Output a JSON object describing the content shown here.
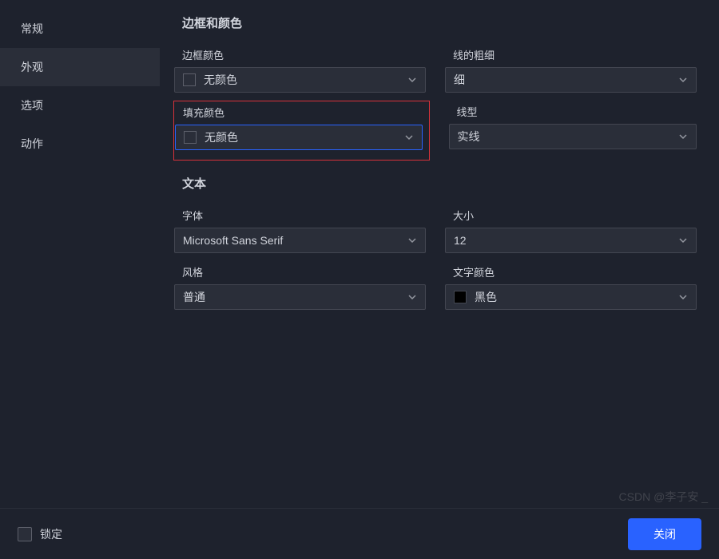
{
  "sidebar": {
    "items": [
      {
        "label": "常规"
      },
      {
        "label": "外观"
      },
      {
        "label": "选项"
      },
      {
        "label": "动作"
      }
    ],
    "activeIndex": 1
  },
  "sections": {
    "border": {
      "title": "边框和颜色",
      "borderColor": {
        "label": "边框颜色",
        "value": "无颜色"
      },
      "lineWeight": {
        "label": "线的粗细",
        "value": "细"
      },
      "fillColor": {
        "label": "填充颜色",
        "value": "无颜色"
      },
      "lineType": {
        "label": "线型",
        "value": "实线"
      }
    },
    "text": {
      "title": "文本",
      "font": {
        "label": "字体",
        "value": "Microsoft Sans Serif"
      },
      "size": {
        "label": "大小",
        "value": "12"
      },
      "style": {
        "label": "风格",
        "value": "普通"
      },
      "textColor": {
        "label": "文字颜色",
        "value": "黑色"
      }
    }
  },
  "footer": {
    "lockLabel": "锁定",
    "closeLabel": "关闭"
  },
  "watermark": "CSDN @李子安 _"
}
